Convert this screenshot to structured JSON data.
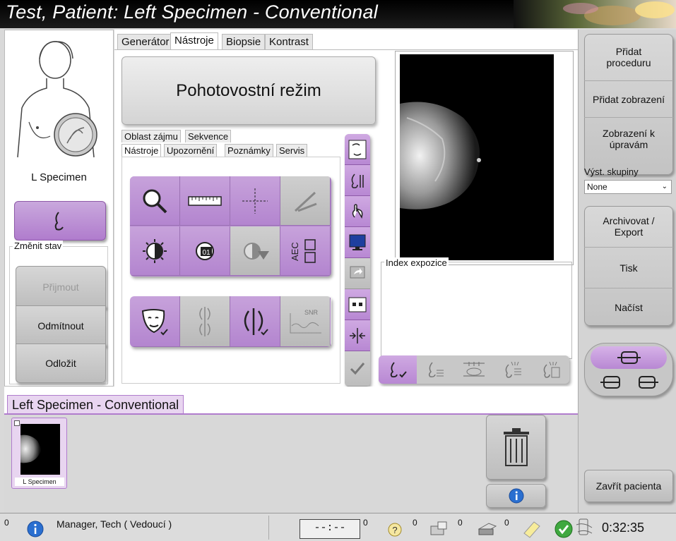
{
  "title": "Test, Patient:  Left Specimen - Conventional",
  "left": {
    "view_label": "L Specimen",
    "change_state_label": "Změnit stav",
    "accept_label": "Přijmout",
    "reject_label": "Odmítnout",
    "pend_label": "Odložit"
  },
  "tabs": [
    "Generátor",
    "Nástroje",
    "Biopsie",
    "Kontrast"
  ],
  "standby_text": "Pohotovostní režim",
  "subtabs_row1": [
    "Oblast zájmu",
    "Sekvence"
  ],
  "subtabs_row2": [
    "Nástroje",
    "Upozornění",
    "Poznámky",
    "Servis"
  ],
  "tools": [
    "magnifier-icon",
    "ruler-icon",
    "crosshair-icon",
    "caliper-icon",
    "contrast-icon",
    "window-level-icon",
    "invert-icon",
    "aec-icon"
  ],
  "tool_aec_text": "AEC",
  "tool_window_text": "01",
  "tool_snr_text": "SNR",
  "exposure_index_label": "Index expozice",
  "right": {
    "add_procedure": "Přidat proceduru",
    "add_view": "Přidat zobrazení",
    "edit_view": "Zobrazení k úpravám",
    "output_groups_label": "Výst. skupiny",
    "output_groups_value": "None",
    "archive_export": "Archivovat / Export",
    "print": "Tisk",
    "load": "Načíst",
    "close_patient": "Zavřít pacienta"
  },
  "procedure_tab": "Left Specimen - Conventional",
  "thumbnail_label": "L Specimen",
  "status": {
    "count_info": "0",
    "user": "Manager, Tech ( Vedoucí )",
    "timer": "--:--",
    "count_timer": "0",
    "count_help": "0",
    "count_net": "0",
    "count_print": "0",
    "time": "0:32:35"
  },
  "colors": {
    "accent_purple": "#b888d3",
    "titlebar": "#000000"
  }
}
